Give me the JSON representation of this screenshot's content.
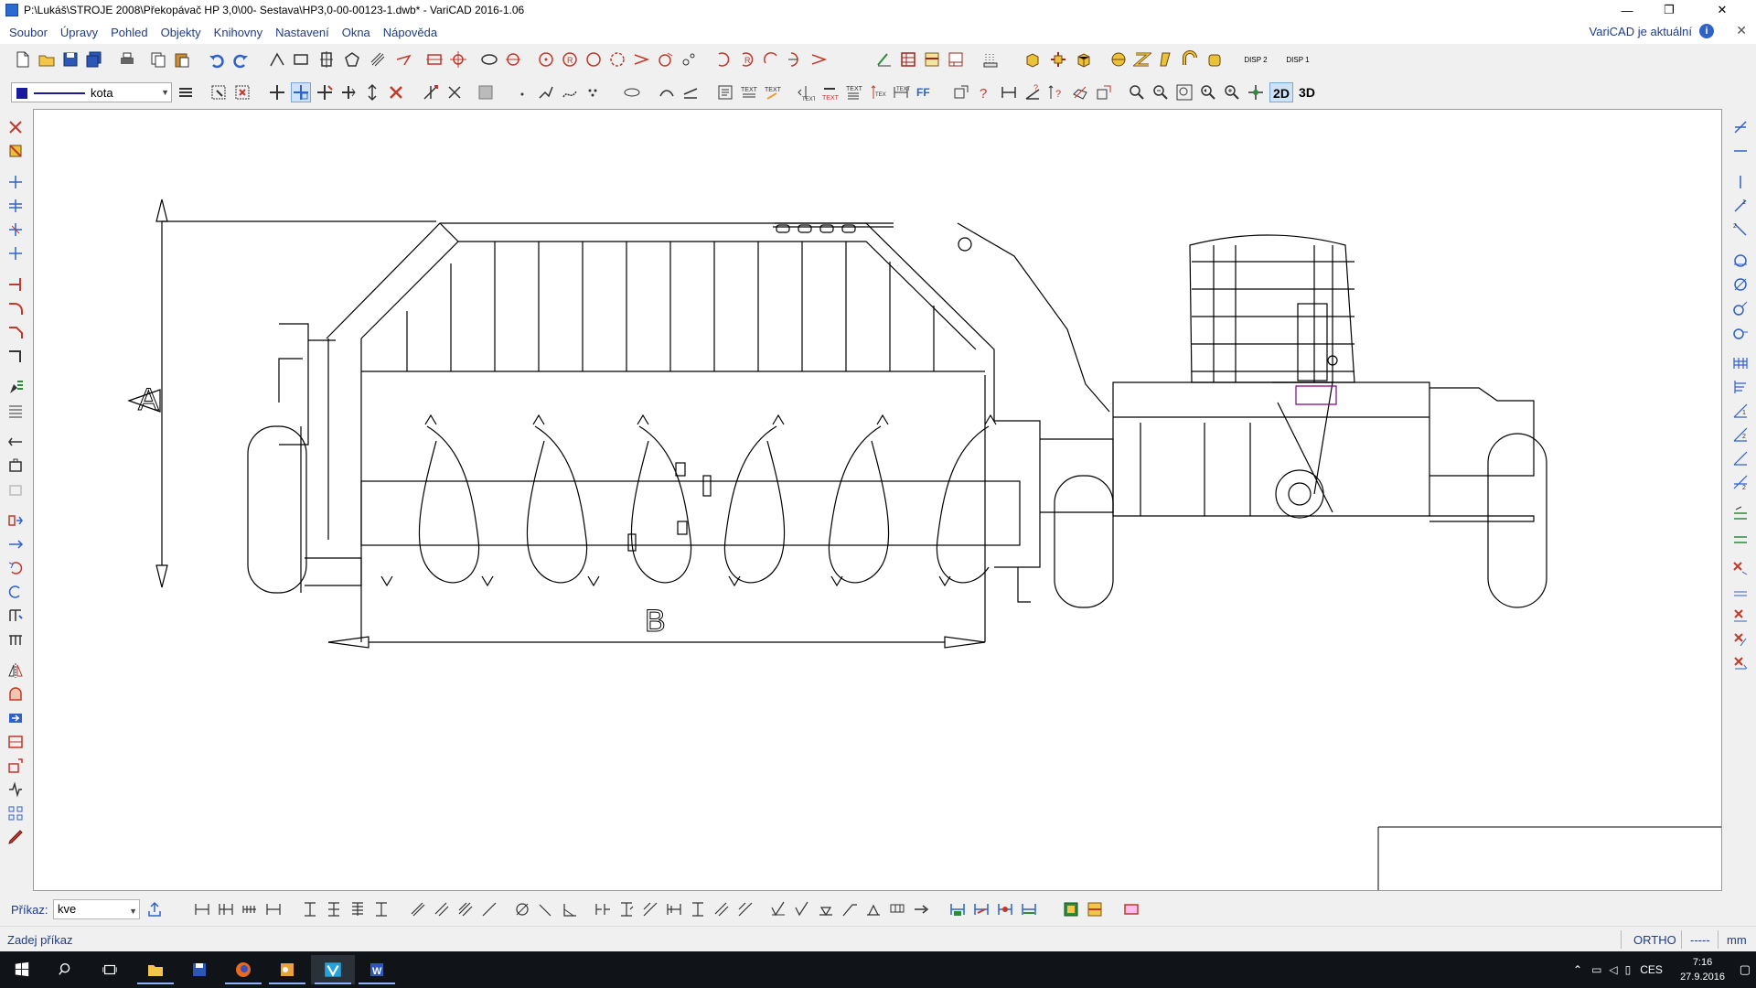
{
  "window": {
    "title": "P:\\Lukáš\\STROJE 2008\\Překopávač HP 3,0\\00- Sestava\\HP3,0-00-00123-1.dwb* - VariCAD 2016-1.06",
    "minimize": "—",
    "restore": "❐",
    "close": "✕"
  },
  "menu": {
    "items": [
      "Soubor",
      "Úpravy",
      "Pohled",
      "Objekty",
      "Knihovny",
      "Nastavení",
      "Okna",
      "Nápověda"
    ],
    "update_status": "VariCAD je aktuální",
    "info_icon": "i",
    "doc_close": "✕"
  },
  "toolbar2": {
    "layer_name": "kota",
    "layer_color": "#1a1aa0",
    "mode_2d": "2D",
    "mode_3d": "3D",
    "disp1": "DISP 2",
    "disp2": "DISP 1"
  },
  "drawing": {
    "section_label_a": "A",
    "section_label_b": "B",
    "line_color": "#000000",
    "accent_color": "#800080"
  },
  "command": {
    "label": "Příkaz:",
    "value": "kve"
  },
  "status": {
    "prompt": "Zadej příkaz",
    "ortho": "ORTHO",
    "dashes": "-----",
    "units": "mm"
  },
  "taskbar": {
    "language": "CES",
    "time": "7:16",
    "date": "27.9.2016"
  },
  "icons": {
    "toolbar1": [
      "new-file",
      "open-file",
      "save",
      "save-all",
      "print",
      "copy",
      "paste",
      "undo",
      "redo",
      "line",
      "rectangle",
      "rect-center",
      "polygon",
      "hatch",
      "arrow-curve",
      "section-line",
      "crosshair",
      "ellipse",
      "rotate-arrows",
      "circle-center",
      "circle-r",
      "circle-3p",
      "circle-tangent",
      "arc",
      "arc-3p",
      "point-grid",
      "arc-left",
      "arc-r",
      "arc-tangent",
      "arc-half",
      "angle",
      "hatch-fill",
      "table",
      "frame",
      "title-block",
      "box-3d",
      "move-3d",
      "cube-3d",
      "tool-a",
      "tool-b",
      "tool-c",
      "tool-d"
    ]
  }
}
